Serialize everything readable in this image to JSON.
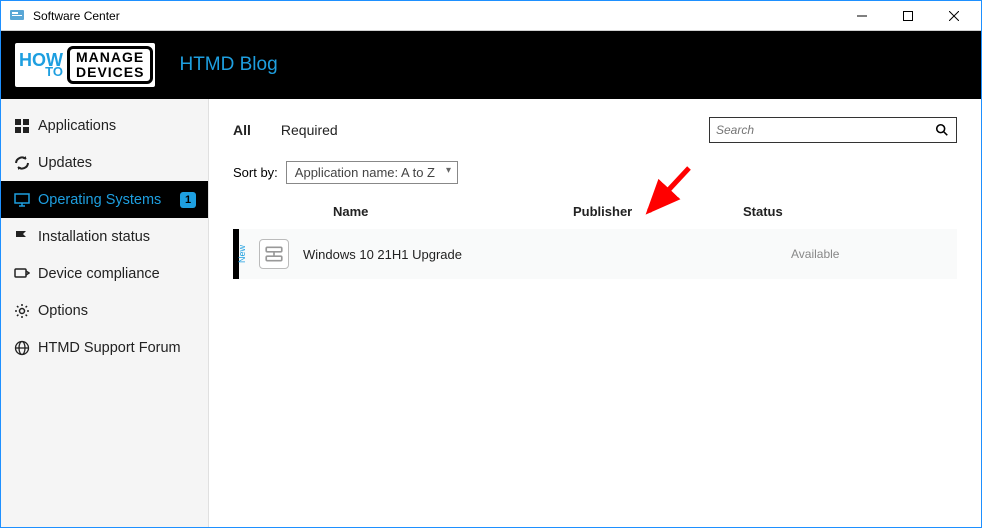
{
  "titlebar": {
    "title": "Software Center"
  },
  "header": {
    "logo_left_top": "HOW",
    "logo_left_bottom": "TO",
    "logo_right_top": "MANAGE",
    "logo_right_bottom": "DEVICES",
    "title": "HTMD Blog"
  },
  "sidebar": {
    "items": [
      {
        "label": "Applications"
      },
      {
        "label": "Updates"
      },
      {
        "label": "Operating Systems",
        "badge": "1"
      },
      {
        "label": "Installation status"
      },
      {
        "label": "Device compliance"
      },
      {
        "label": "Options"
      },
      {
        "label": "HTMD Support Forum"
      }
    ]
  },
  "filters": {
    "all": "All",
    "required": "Required"
  },
  "search": {
    "placeholder": "Search"
  },
  "sort": {
    "label": "Sort by:",
    "selected": "Application name: A to Z"
  },
  "columns": {
    "name": "Name",
    "publisher": "Publisher",
    "status": "Status"
  },
  "rows": [
    {
      "new_label": "New",
      "name": "Windows 10 21H1 Upgrade",
      "publisher": "",
      "status": "Available"
    }
  ]
}
